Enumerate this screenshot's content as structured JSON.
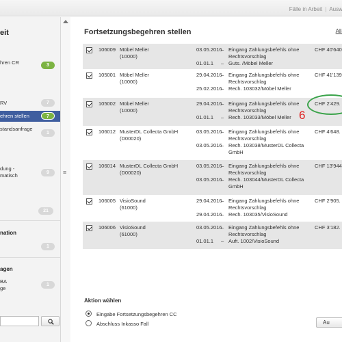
{
  "topbar": {
    "link_in_arbeit": "Fälle in Arbeit",
    "link_auswertung": "Auswer"
  },
  "sidebar": {
    "title": "eit",
    "items": [
      {
        "label": "hren CR",
        "badge": "3",
        "badge_color": "#7cb342"
      },
      {
        "label": "RV",
        "badge": "7",
        "badge_color": "#d8d8d8"
      },
      {
        "label": "ehren stellen",
        "badge": "7",
        "badge_color": "#7cb342",
        "active": true
      },
      {
        "label": "standsanfrage",
        "badge": "1",
        "badge_color": "#d8d8d8"
      },
      {
        "label_line1": "dung -",
        "label_line2": "matisch",
        "badge": "9",
        "badge_color": "#d8d8d8"
      },
      {
        "label": "",
        "badge": "21",
        "badge_color": "#d8d8d8"
      }
    ],
    "section1": "nation",
    "section1_badge": "1",
    "section2": "agen",
    "section2_item_line1": "BA",
    "section2_item_line2": "ge",
    "section2_badge": "1"
  },
  "main": {
    "title": "Fortsetzungsbegehren stellen",
    "all_link": "Alle",
    "rows": [
      {
        "id": "106009",
        "name1": "Möbel Meller",
        "name2": "(10000)",
        "date1": "03.05.2016",
        "desc1a": "Eingang Zahlungsbefehls ohne",
        "desc1b": "Rechtsvorschlag",
        "date2": "01.01.1",
        "desc2": "Guts. /Möbel Meller",
        "amount": "CHF 40'640",
        "shaded": true
      },
      {
        "id": "105001",
        "name1": "Möbel Meller",
        "name2": "(10000)",
        "date1": "29.04.2016",
        "desc1a": "Eingang Zahlungsbefehls ohne",
        "desc1b": "Rechtsvorschlag",
        "date2": "25.02.2016",
        "desc2": "Rech. 103032/Möbel Meller",
        "amount": "CHF 41'139",
        "shaded": false
      },
      {
        "id": "105002",
        "name1": "Möbel Meller",
        "name2": "(10000)",
        "date1": "29.04.2016",
        "desc1a": "Eingang Zahlungsbefehls ohne",
        "desc1b": "Rechtsvorschlag",
        "date2": "01.01.1",
        "desc2": "Rech. 103033/Möbel Meller",
        "amount": "CHF 2'429.",
        "shaded": true
      },
      {
        "id": "106012",
        "name1": "MusterDL Collecta GmbH",
        "name2": "(D00020)",
        "date1": "03.05.2016",
        "desc1a": "Eingang Zahlungsbefehls ohne",
        "desc1b": "Rechtsvorschlag",
        "date2": "03.05.2016",
        "desc2a": "Rech. 103038/MusterDL Collecta",
        "desc2b": "GmbH",
        "amount": "CHF 4'648.",
        "shaded": false
      },
      {
        "id": "106014",
        "name1": "MusterDL Collecta GmbH",
        "name2": "(D00020)",
        "date1": "03.05.2016",
        "desc1a": "Eingang Zahlungsbefehls ohne",
        "desc1b": "Rechtsvorschlag",
        "date2": "03.05.2016",
        "desc2a": "Rech. 103044/MusterDL Collecta",
        "desc2b": "GmbH",
        "amount": "CHF 13'944",
        "shaded": true
      },
      {
        "id": "106005",
        "name1": "VisioSound",
        "name2": "(61000)",
        "date1": "29.04.2016",
        "desc1a": "Eingang Zahlungsbefehls ohne",
        "desc1b": "Rechtsvorschlag",
        "date2": "29.04.2016",
        "desc2": "Rech. 103035/VisioSound",
        "amount": "CHF 2'905.",
        "shaded": false
      },
      {
        "id": "106006",
        "name1": "VisioSound",
        "name2": "(61000)",
        "date1": "03.05.2016",
        "desc1a": "Eingang Zahlungsbefehls ohne",
        "desc1b": "Rechtsvorschlag",
        "date2": "01.01.1",
        "desc2": "Auft. 1002/VisioSound",
        "amount": "CHF 3'182.",
        "shaded": true
      }
    ],
    "dash": "–",
    "annotation_number": "6",
    "annotation_color": "#3aa34a",
    "action_title": "Aktion wählen",
    "radio1": "Eingabe Fortsetzungsbegehren CC",
    "radio2": "Abschluss Inkasso Fall",
    "bottom_button": "Au"
  }
}
